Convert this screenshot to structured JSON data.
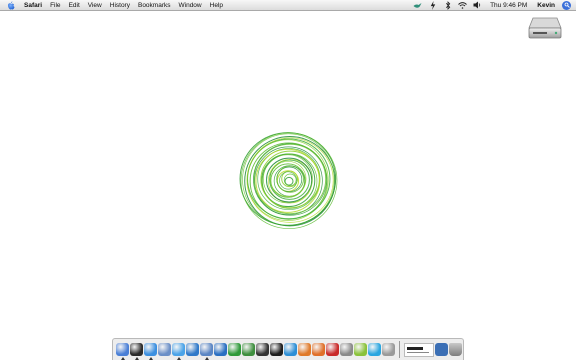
{
  "menubar": {
    "app_name": "Safari",
    "menus": [
      "File",
      "Edit",
      "View",
      "History",
      "Bookmarks",
      "Window",
      "Help"
    ],
    "clock": "Thu 9:46 PM",
    "user": "Kevin"
  },
  "dock": {
    "items": [
      {
        "icon": "finder-icon",
        "color": "#4a7fd6",
        "running": true
      },
      {
        "icon": "dashboard-icon",
        "color": "#2b2b2b",
        "running": true
      },
      {
        "icon": "safari-icon",
        "color": "#3b8fe0",
        "running": true
      },
      {
        "icon": "mail-icon",
        "color": "#6b8fc7",
        "running": false
      },
      {
        "icon": "ichat-icon",
        "color": "#4aa3e8",
        "running": true
      },
      {
        "icon": "quicktime-icon",
        "color": "#2f79c9",
        "running": false
      },
      {
        "icon": "preview-icon",
        "color": "#5b86c4",
        "running": true
      },
      {
        "icon": "word-icon",
        "color": "#2a6fc2",
        "running": false
      },
      {
        "icon": "excel-icon",
        "color": "#2f9a3a",
        "running": false
      },
      {
        "icon": "growl-icon",
        "color": "#3f8f3f",
        "running": false
      },
      {
        "icon": "terminal-icon",
        "color": "#333333",
        "running": false
      },
      {
        "icon": "camino-icon",
        "color": "#1e1e1e",
        "running": false
      },
      {
        "icon": "pen-icon",
        "color": "#2d8fd6",
        "running": false
      },
      {
        "icon": "feather-icon",
        "color": "#e07a2a",
        "running": false
      },
      {
        "icon": "firefox-icon",
        "color": "#e0702a",
        "running": false
      },
      {
        "icon": "flash-icon",
        "color": "#c92a2a",
        "running": false
      },
      {
        "icon": "utility-icon",
        "color": "#8a8a8a",
        "running": false
      },
      {
        "icon": "android-icon",
        "color": "#8ac23a",
        "running": false
      },
      {
        "icon": "skype-icon",
        "color": "#2aa6e0",
        "running": false
      },
      {
        "icon": "system-preferences-icon",
        "color": "#9a9a9a",
        "running": false
      }
    ],
    "trailing": [
      {
        "icon": "document-thumbnail-icon"
      },
      {
        "icon": "downloads-stack-icon",
        "color": "#3b6fb5"
      },
      {
        "icon": "trash-icon",
        "color": "#8f8f8f"
      }
    ]
  },
  "desktop": {
    "drive_icon": "hard-drive-icon",
    "centerpiece": "green-swirl-logo-icon"
  }
}
